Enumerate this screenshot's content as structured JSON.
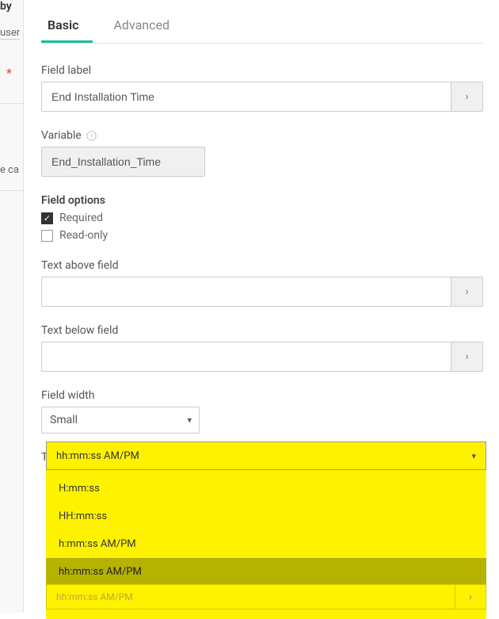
{
  "left": {
    "by": "by",
    "user": "user",
    "asterisk": "*",
    "ca": "e ca"
  },
  "tabs": {
    "basic": "Basic",
    "advanced": "Advanced"
  },
  "labels": {
    "field_label": "Field label",
    "variable": "Variable",
    "field_options": "Field options",
    "required": "Required",
    "readonly": "Read-only",
    "text_above": "Text above field",
    "text_below": "Text below field",
    "field_width": "Field width",
    "time_format": "Time format"
  },
  "values": {
    "field_label": "End Installation Time",
    "variable": "End_Installation_Time",
    "text_above": "",
    "text_below": "",
    "field_width": "Small",
    "time_format": "hh:mm:ss AM/PM",
    "ghost": "hh:mm:ss AM/PM"
  },
  "options": {
    "time_format": [
      "H:mm:ss",
      "HH:mm:ss",
      "h:mm:ss AM/PM",
      "hh:mm:ss AM/PM"
    ]
  },
  "icons": {
    "chevron_right": "›",
    "chevron_down": "▾",
    "check": "✓"
  }
}
